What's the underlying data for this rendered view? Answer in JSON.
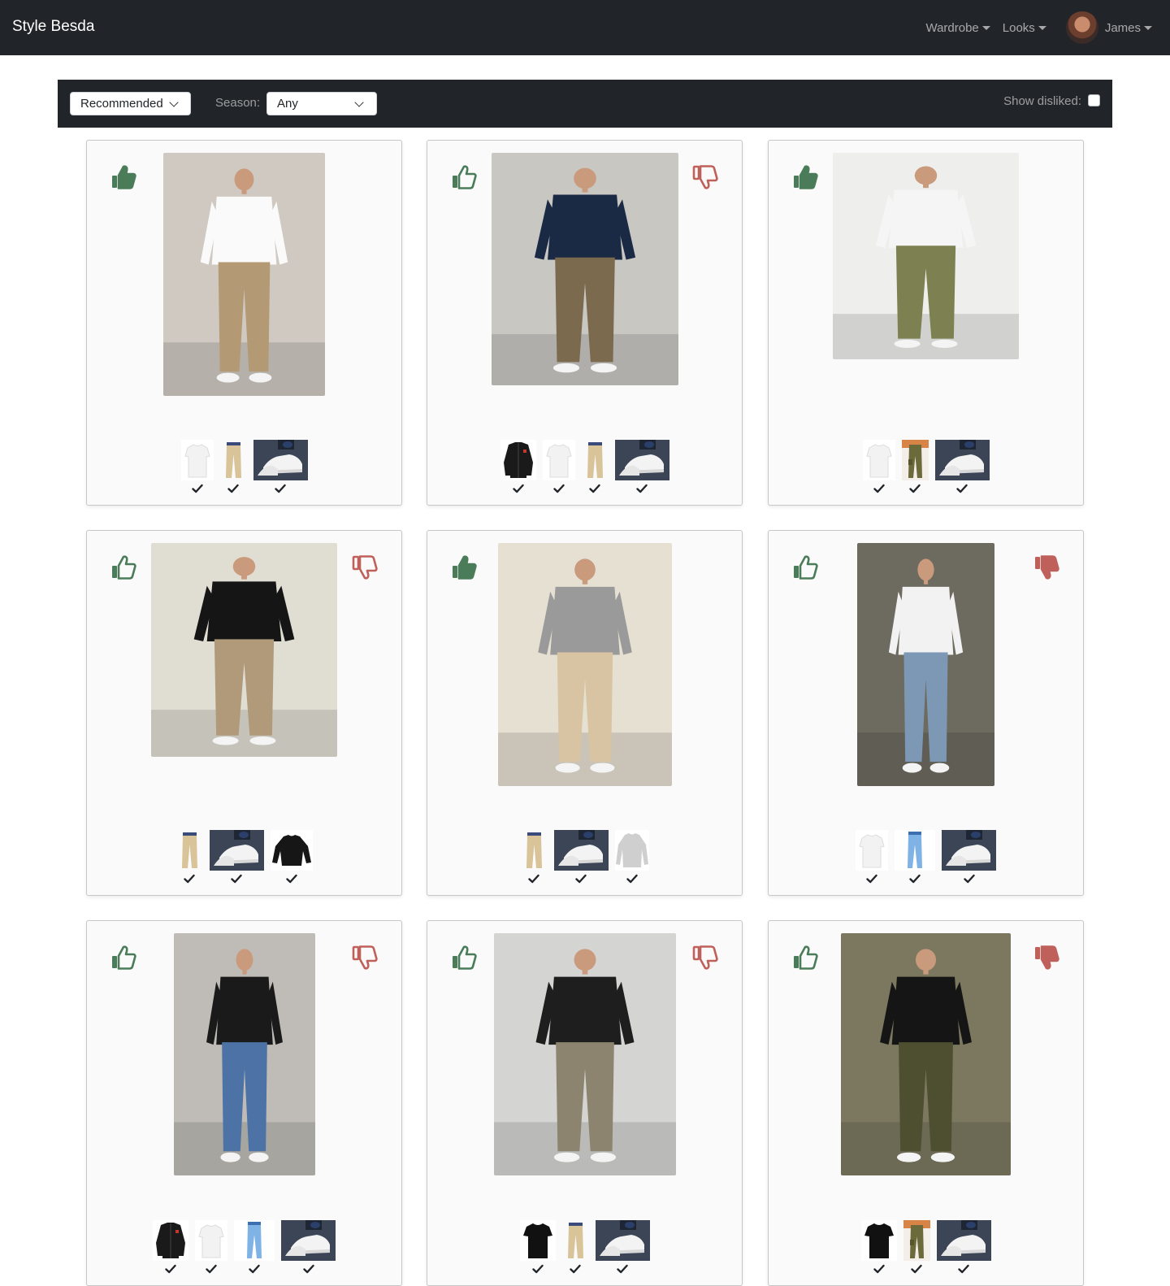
{
  "app": {
    "brand": "Style Besda"
  },
  "nav": {
    "wardrobe": "Wardrobe",
    "looks": "Looks",
    "user": "James"
  },
  "filters": {
    "sort_value": "Recommended",
    "season_label": "Season:",
    "season_value": "Any",
    "show_disliked_label": "Show disliked:",
    "show_disliked_checked": false
  },
  "colors": {
    "like": "#4a7c59",
    "dislike": "#c0605a",
    "navbar": "#212529"
  },
  "looks": [
    {
      "liked": true,
      "disliked": false,
      "show_dislike": false,
      "items": [
        "white-tshirt",
        "khaki-pants",
        "white-sneakers"
      ]
    },
    {
      "liked": false,
      "disliked": false,
      "show_dislike": true,
      "items": [
        "black-bomber",
        "white-tshirt",
        "khaki-pants",
        "white-sneakers"
      ]
    },
    {
      "liked": true,
      "disliked": false,
      "show_dislike": false,
      "items": [
        "white-tshirt",
        "olive-cargo",
        "white-sneakers"
      ]
    },
    {
      "liked": false,
      "disliked": false,
      "show_dislike": true,
      "items": [
        "khaki-pants",
        "white-sneakers",
        "black-sweater"
      ]
    },
    {
      "liked": true,
      "disliked": false,
      "show_dislike": false,
      "items": [
        "khaki-pants",
        "white-sneakers",
        "grey-sweater"
      ]
    },
    {
      "liked": false,
      "disliked": true,
      "show_dislike": true,
      "items": [
        "white-tshirt",
        "blue-jeans",
        "white-sneakers"
      ]
    },
    {
      "liked": false,
      "disliked": false,
      "show_dislike": true,
      "items": [
        "black-bomber",
        "white-tshirt",
        "blue-jeans",
        "white-sneakers"
      ]
    },
    {
      "liked": false,
      "disliked": false,
      "show_dislike": true,
      "items": [
        "black-tshirt",
        "khaki-pants",
        "white-sneakers"
      ]
    },
    {
      "liked": false,
      "disliked": true,
      "show_dislike": true,
      "items": [
        "black-tshirt",
        "olive-cargo",
        "white-sneakers"
      ]
    }
  ]
}
